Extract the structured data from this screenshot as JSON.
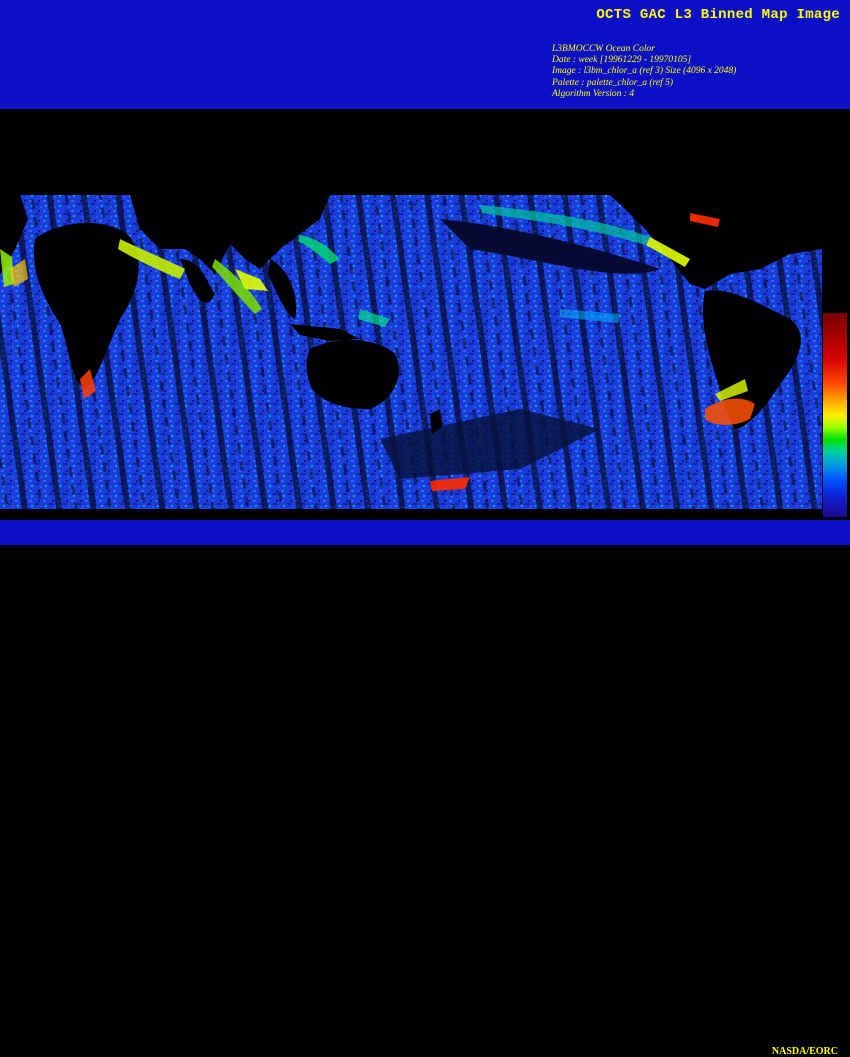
{
  "header": {
    "title": "OCTS GAC L3 Binned Map Image",
    "meta": {
      "line1": "L3BMOCCW Ocean Color",
      "line2": "Date : week [19961229 - 19970105]",
      "line3": "Image : l3bm_chlor_a (ref 3) Size (4096 x 2048)",
      "line4": "Palette : palette_chlor_a (ref 5)",
      "line5": "Algorithm Version : 4"
    }
  },
  "footer": {
    "credit": "NASDA/EORC"
  },
  "colors": {
    "band": "#0b10c8",
    "text": "#ffff00",
    "land": "#000000",
    "ocean_low": "#1a3cd8",
    "ocean_mid": "#00b4ff",
    "ocean_high": "#e0ff00",
    "ocean_max": "#d40000"
  },
  "palette": {
    "label": ""
  }
}
